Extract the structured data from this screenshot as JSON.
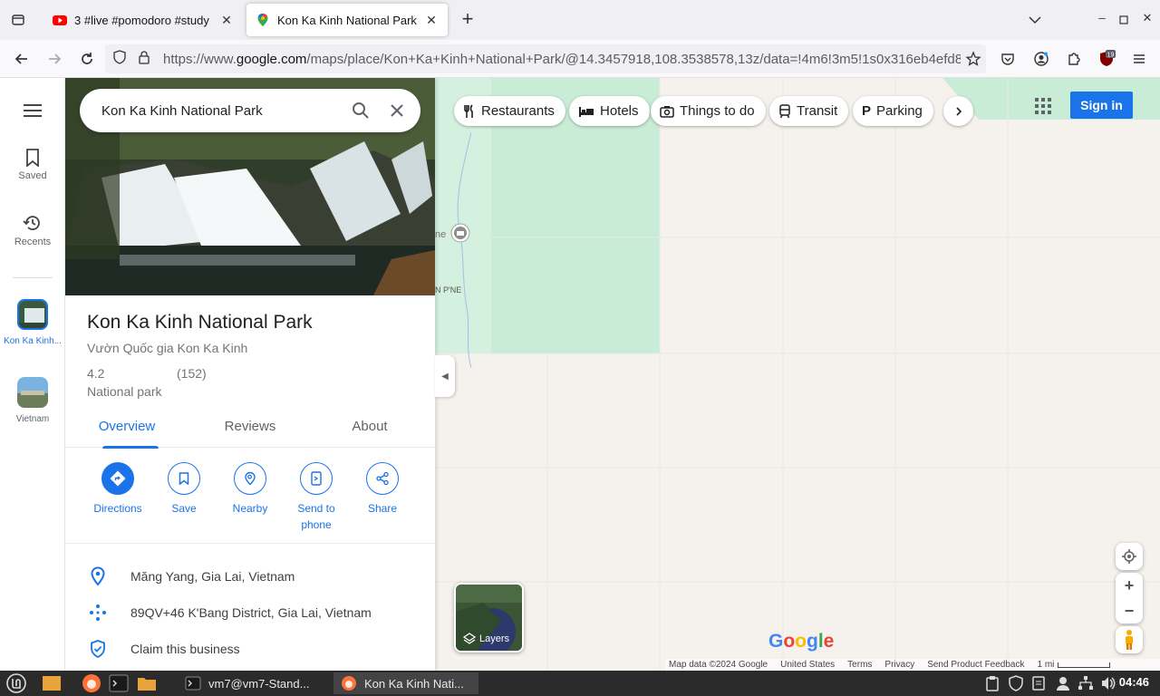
{
  "browser": {
    "tabs": [
      {
        "title": "3 #live #pomodoro #study",
        "active": false,
        "favicon": "youtube-icon"
      },
      {
        "title": "Kon Ka Kinh National Park",
        "active": true,
        "favicon": "google-maps-pin-icon"
      }
    ],
    "url_prefix": "https://www.",
    "url_domain": "google.com",
    "url_rest": "/maps/place/Kon+Ka+Kinh+National+Park/@14.3457918,108.3538578,13z/data=!4m6!3m5!1s0x316eb4efd810c",
    "extension_badge": "19"
  },
  "rail": {
    "saved_label": "Saved",
    "recents_label": "Recents",
    "recent_place_label": "Kon Ka Kinh...",
    "vietnam_label": "Vietnam"
  },
  "search": {
    "query": "Kon Ka Kinh National Park"
  },
  "place": {
    "name": "Kon Ka Kinh National Park",
    "local_name": "Vườn Quốc gia Kon Ka Kinh",
    "rating": "4.2",
    "review_count": "(152)",
    "category": "National park",
    "tabs": [
      "Overview",
      "Reviews",
      "About"
    ],
    "actions": {
      "directions": "Directions",
      "save": "Save",
      "nearby": "Nearby",
      "send_to_phone_1": "Send to",
      "send_to_phone_2": "phone",
      "share": "Share"
    },
    "address": "Măng Yang, Gia Lai, Vietnam",
    "plus_code": "89QV+46 K'Bang District, Gia Lai, Vietnam",
    "claim": "Claim this business"
  },
  "map": {
    "chips": [
      "Restaurants",
      "Hotels",
      "Things to do",
      "Transit",
      "Parking"
    ],
    "sign_in": "Sign in",
    "layers_label": "Layers",
    "map_label_1": "ne",
    "map_label_2": "N P'NE",
    "attribution": {
      "map_data": "Map data ©2024 Google",
      "region": "United States",
      "terms": "Terms",
      "privacy": "Privacy",
      "feedback": "Send Product Feedback",
      "scale": "1 mi"
    },
    "logo_text": "Google"
  },
  "taskbar": {
    "terminal_task": "vm7@vm7-Stand...",
    "browser_task": "Kon Ka Kinh Nati...",
    "clock": "04:46"
  },
  "colors": {
    "accent": "#1a73e8",
    "park_green": "#c8ecd6",
    "map_bg": "#f5f2ed"
  }
}
